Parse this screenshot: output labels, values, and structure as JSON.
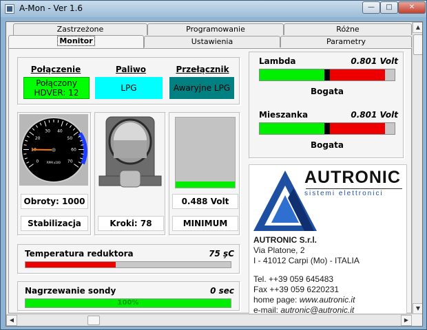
{
  "window": {
    "title": "A-Mon - Ver 1.6",
    "min_glyph": "—",
    "max_glyph": "□",
    "close_glyph": "✕"
  },
  "tabs": {
    "row_back": [
      {
        "label": "Zastrzeżone"
      },
      {
        "label": "Programowanie"
      },
      {
        "label": "Różne"
      }
    ],
    "row_front": [
      {
        "label": "Monitor",
        "active": true
      },
      {
        "label": "Ustawienia"
      },
      {
        "label": "Parametry"
      }
    ]
  },
  "status": {
    "connection": {
      "header": "Połączenie",
      "line1": "Połączony",
      "line2": "HDVER: 12",
      "color": "#00ff00"
    },
    "fuel": {
      "header": "Paliwo",
      "value": "LPG",
      "color": "#00ffff"
    },
    "switch": {
      "header": "Przełącznik",
      "value": "Awaryjne LPG",
      "color": "#008080"
    }
  },
  "gauges": {
    "rpm": {
      "value": "Obroty: 1000",
      "state": "Stabilizacja",
      "needle_rpm": 1000,
      "dial_labels": [
        "0",
        "10",
        "20",
        "30",
        "40",
        "50",
        "60",
        "70"
      ],
      "dial_unit": "RPM x100"
    },
    "stepper": {
      "value": "Kroki: 78"
    },
    "sensor": {
      "value": "0.488 Volt",
      "state": "MINIMUM"
    }
  },
  "temperature": {
    "label": "Temperatura reduktora",
    "value": "75 şC",
    "fill_fraction": 0.44,
    "color": "#ee0000"
  },
  "heating": {
    "label": "Nagrzewanie sondy",
    "value": "0 sec",
    "fill_fraction": 1.0,
    "bar_text": "100%",
    "color": "#00ee00"
  },
  "lambda": {
    "label": "Lambda",
    "value": "0.801 Volt",
    "state": "Bogata",
    "marker_fraction": 0.5
  },
  "mixture": {
    "label": "Mieszanka",
    "value": "0.801 Volt",
    "state": "Bogata",
    "marker_fraction": 0.5
  },
  "company": {
    "brand": "AUTRONIC",
    "tagline": "sistemi elettronici",
    "name": "AUTRONIC S.r.l.",
    "address1": "Via Platone, 2",
    "address2": "I - 41012 Carpi (Mo) - ITALIA",
    "tel": "Tel. ++39 059 645483",
    "fax": "Fax ++39 059 6220231",
    "homepage_label": "home page:",
    "homepage": "www.autronic.it",
    "email_label": "e-mail:",
    "email": "autronic@autronic.it",
    "logo_color": "#1f4fa0"
  }
}
